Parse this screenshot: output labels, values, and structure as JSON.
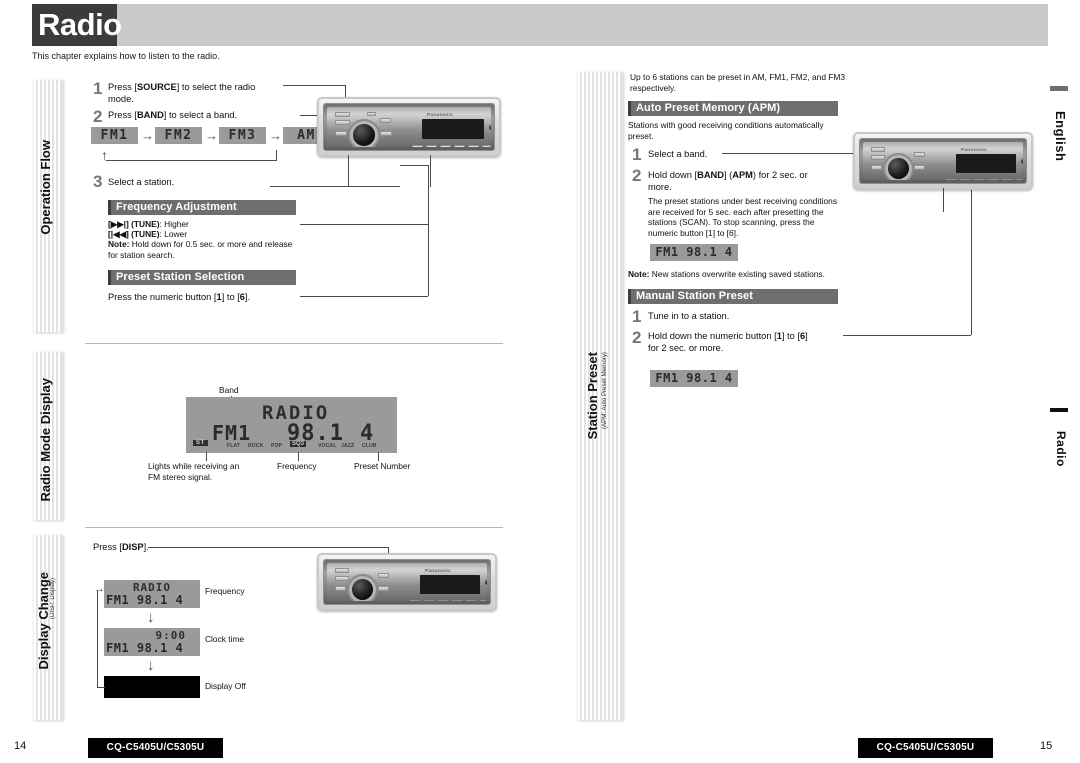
{
  "header": {
    "title": "Radio",
    "intro": "This chapter explains how to listen to the radio."
  },
  "side_tabs": {
    "language": "English",
    "chapter": "Radio"
  },
  "left_page": {
    "page_number": "14",
    "footer_model": "CQ-C5405U/C5305U",
    "sections": [
      {
        "sidebar_label": "Operation Flow",
        "sidebar_sub": "",
        "steps": [
          {
            "num": "1",
            "text_parts": [
              "Press [",
              "SOURCE",
              "] to select the radio mode."
            ]
          },
          {
            "num": "2",
            "text_parts": [
              "Press [",
              "BAND",
              "] to select a band."
            ]
          },
          {
            "num": "3",
            "text_parts": [
              "Select a station."
            ]
          }
        ],
        "step1_line1": "Press [SOURCE] to select the radio",
        "step1_line2": "mode.",
        "step1_pre": "Press [",
        "step1_bold": "SOURCE",
        "step1_post": "] to select the radio",
        "step1_post2": "mode.",
        "step2_pre": "Press [",
        "step2_bold": "BAND",
        "step2_post": "] to select a band.",
        "step3_text": "Select a station.",
        "band_chips": [
          "FM1",
          "FM2",
          "FM3",
          "AM"
        ],
        "band_arrow": "→",
        "loop_arrow": "↑",
        "subsections": [
          {
            "title": "Frequency Adjustment",
            "lines": [
              {
                "bold": "[▶▶|] (TUNE)",
                "rest": ": Higher"
              },
              {
                "bold": "[|◀◀] (TUNE)",
                "rest": ": Lower"
              },
              {
                "bold": "Note:",
                "rest": " Hold down for 0.5 sec. or more and release"
              },
              {
                "bold": "",
                "rest": "for station search."
              }
            ]
          },
          {
            "title": "Preset Station Selection",
            "body_pre": "Press the numeric button [",
            "body_b1": "1",
            "body_mid": "] to [",
            "body_b2": "6",
            "body_post": "]."
          }
        ]
      },
      {
        "sidebar_label": "Radio Mode Display",
        "sidebar_sub": "",
        "display": {
          "line_top": "RADIO",
          "band": "FM1",
          "frequency": "98.1",
          "preset": "4",
          "stereo_indicator": "ST",
          "eq_labels": [
            "FLAT",
            "ROCK",
            "POP",
            "VOCAL",
            "JAZZ",
            "CLUB"
          ],
          "sq_label": "SQ3"
        },
        "callouts": {
          "band": "Band",
          "frequency": "Frequency",
          "preset": "Preset Number",
          "stereo_line1": "Lights while receiving an",
          "stereo_line2": "FM stereo signal."
        }
      },
      {
        "sidebar_label": "Display Change",
        "sidebar_sub": "(DISP: Display)",
        "intro_pre": "Press [",
        "intro_bold": "DISP",
        "intro_post": "].",
        "steps": [
          {
            "line_top": "RADIO",
            "line_bottom": "FM1  98.1  4",
            "label": "Frequency",
            "off": false,
            "top_align": "center"
          },
          {
            "line_top": "9:00",
            "line_bottom": "FM1  98.1  4",
            "label": "Clock time",
            "off": false,
            "top_align": "right"
          },
          {
            "line_top": "",
            "line_bottom": "",
            "label": "Display Off",
            "off": true,
            "top_align": "center"
          }
        ],
        "arrow_down": "↓"
      }
    ]
  },
  "right_page": {
    "page_number": "15",
    "footer_model": "CQ-C5405U/C5305U",
    "sidebar_label": "Station Preset",
    "sidebar_sub": "(APM: Auto Preset Memory)",
    "intro_line1": "Up to 6 stations can be preset in AM, FM1, FM2, and FM3",
    "intro_line2": "respectively.",
    "apm": {
      "title": "Auto Preset Memory (APM)",
      "desc_line1": "Stations with good receiving conditions automatically",
      "desc_line2": "preset.",
      "step1_num": "1",
      "step1_text": "Select a band.",
      "step2_num": "2",
      "step2_pre": "Hold down [",
      "step2_b1": "BAND",
      "step2_mid": "] (",
      "step2_b2": "APM",
      "step2_post": ") for 2 sec. or",
      "step2_line2": "more.",
      "body_lines": [
        "The preset stations under best receiving conditions",
        "are received for 5 sec. each after presetting the",
        "stations (SCAN). To stop scanning, press the",
        "numeric button [1] to [6]."
      ],
      "display": "FM1  98.1  4",
      "note_bold": "Note:",
      "note_rest": " New stations overwrite existing saved stations."
    },
    "manual": {
      "title": "Manual Station Preset",
      "step1_num": "1",
      "step1_text": "Tune in to a station.",
      "step2_num": "2",
      "step2_pre": "Hold down the numeric button [",
      "step2_b1": "1",
      "step2_mid": "] to [",
      "step2_b2": "6",
      "step2_post": "]",
      "step2_line2": "for 2 sec. or more.",
      "display": "FM1  98.1  4"
    }
  },
  "unit_graphic": {
    "brand": "Panasonic",
    "preset_button_labels": [
      "1",
      "2",
      "3",
      "4",
      "5",
      "6"
    ]
  },
  "colors": {
    "header_band": "#c9c9c9",
    "header_box": "#3b3b3b",
    "section_bar": "#6e6e6e",
    "section_bar_edge": "#3d3d3d",
    "lcd_background": "#9a9a9a",
    "step_number": "#767676",
    "footer_box": "#000000"
  }
}
